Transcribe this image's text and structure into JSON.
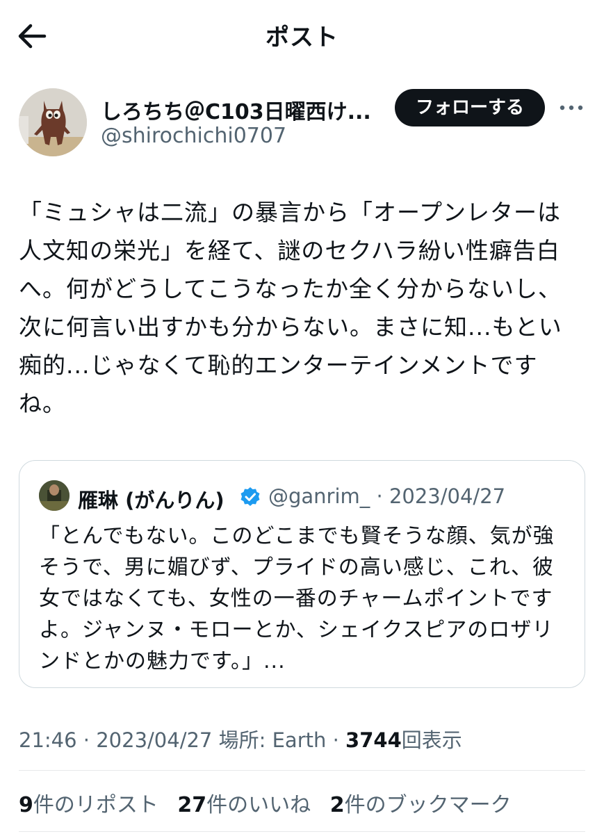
{
  "header": {
    "title": "ポスト"
  },
  "author": {
    "display_name": "しろちち＠C103日曜西け...",
    "handle": "@shirochichi0707",
    "follow_label": "フォローする"
  },
  "post": {
    "text": "「ミュシャは二流」の暴言から「オープンレターは\n人文知の栄光」を経て、謎のセクハラ紛い性癖告白\nへ。何がどうしてこうなったか全く分からないし、\n次に何言い出すかも分からない。まさに知...もとい\n痴的...じゃなくて恥的エンターテインメントです\nね。"
  },
  "quote": {
    "display_name": "雁琳 (がんりん)",
    "handle": "@ganrim_",
    "separator": "·",
    "date": "2023/04/27",
    "text": "「とんでもない。このどこまでも賢そうな顔、気が強\nそうで、男に媚びず、プライドの高い感じ、これ、彼\n女ではなくても、女性の一番のチャームポイントです\nよ。ジャンヌ・モローとか、シェイクスピアのロザリ\nンドとかの魅力です。」..."
  },
  "meta": {
    "time": "21:46",
    "dot1": "·",
    "date": "2023/04/27",
    "location_label": "場所: Earth",
    "dot2": "·",
    "views_count": "3744",
    "views_label": "回表示"
  },
  "stats": {
    "reposts_count": "9",
    "reposts_label": "件のリポスト",
    "likes_count": "27",
    "likes_label": "件のいいね",
    "bookmarks_count": "2",
    "bookmarks_label": "件のブックマーク"
  },
  "colors": {
    "text": "#0f1419",
    "secondary": "#536471",
    "border": "#cfd9de",
    "verified": "#1d9bf0",
    "follow_bg": "#0f1419"
  },
  "icons": {
    "back": "arrow-left-icon",
    "more": "more-horizontal-icon",
    "verified": "verified-badge-icon"
  }
}
